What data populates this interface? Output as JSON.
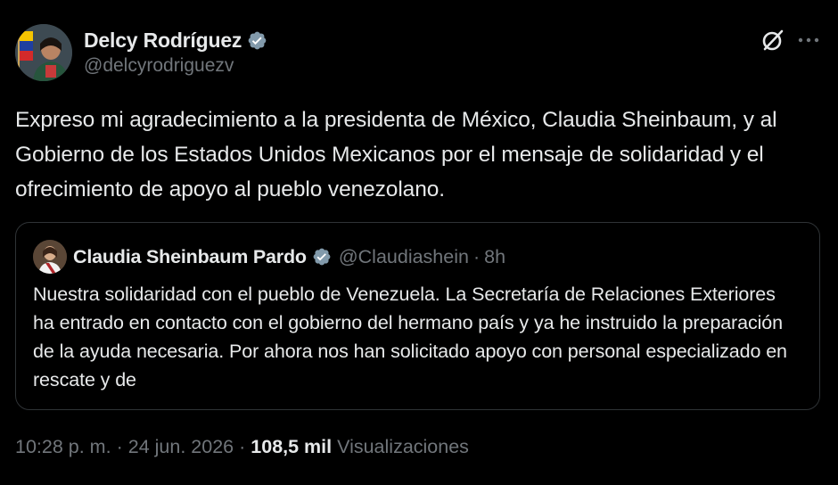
{
  "tweet": {
    "author": {
      "display_name": "Delcy Rodríguez",
      "handle": "@delcyrodriguezv",
      "verified_color": "#829aab"
    },
    "text": "Expreso mi agradecimiento a la presidenta de México, Claudia Sheinbaum, y al Gobierno de los Estados Unidos Mexicanos por el mensaje de solidaridad y el ofrecimiento de apoyo al pueblo venezolano.",
    "actions": {
      "grok_icon": "grok-icon",
      "more_icon": "more-icon"
    },
    "quoted": {
      "display_name": "Claudia Sheinbaum Pardo",
      "handle": "@Claudiashein",
      "separator": "·",
      "time": "8h",
      "verified_color": "#829aab",
      "text": "Nuestra solidaridad con el pueblo de Venezuela. La Secretaría de Relaciones Exteriores ha entrado en contacto con el gobierno del hermano país y ya he instruido la preparación de la ayuda necesaria. Por ahora nos han solicitado apoyo con personal especializado en rescate y de"
    },
    "meta": {
      "time": "10:28 p. m.",
      "separator": "·",
      "date": "24 jun. 2026",
      "views_count": "108,5 mil",
      "views_label": "Visualizaciones"
    }
  },
  "colors": {
    "background": "#000000",
    "text_primary": "#e7e9ea",
    "text_secondary": "#71767b",
    "border": "#2f3336"
  }
}
